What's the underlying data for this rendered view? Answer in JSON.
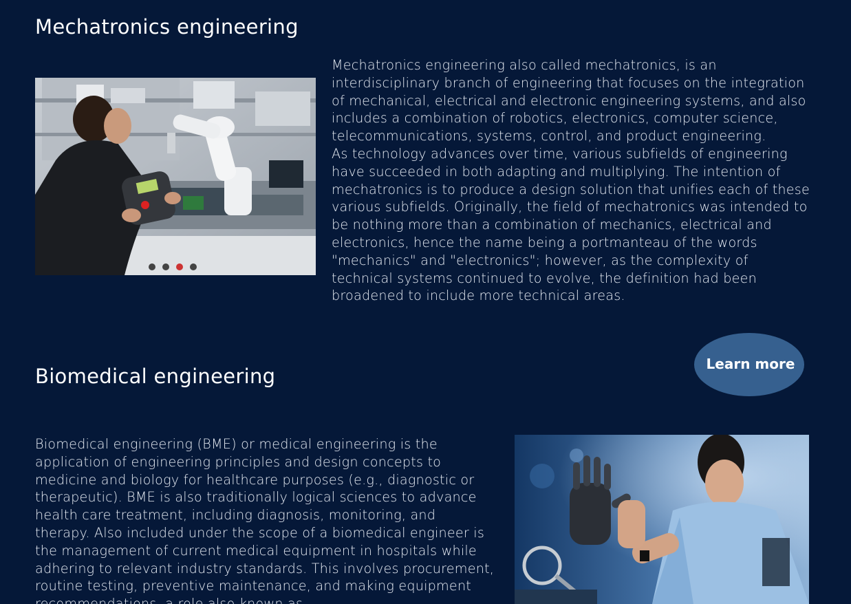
{
  "sections": {
    "mechatronics": {
      "title": "Mechatronics engineering",
      "paragraph1": "Mechatronics engineering also called mechatronics, is an interdisciplinary branch of engineering that focuses on the integration of mechanical, electrical and electronic engineering systems, and also includes a combination of robotics, electronics, computer science, telecommunications, systems, control, and product engineering.",
      "paragraph2": "As technology advances over time, various subfields of engineering have succeeded in both adapting and multiplying. The intention of mechatronics is to produce a design solution that unifies each of these various subfields. Originally, the field of mechatronics was intended to be nothing more than a combination of mechanics, electrical and electronics, hence the name being a portmanteau of the words \"mechanics\" and \"electronics\"; however, as the complexity of technical systems continued to evolve, the definition had been broadened to include more technical areas.",
      "image_subject": "engineer-with-robot-arm-photo"
    },
    "biomedical": {
      "title": "Biomedical engineering",
      "paragraph": "Biomedical engineering (BME) or medical engineering is the application of engineering principles and design concepts to medicine and biology for healthcare purposes (e.g., diagnostic or therapeutic). BME is also traditionally logical sciences to advance health care treatment, including diagnosis, monitoring, and therapy. Also included under the scope of a biomedical engineer is the management of current medical equipment in hospitals while adhering to relevant industry standards. This involves procurement, routine testing, preventive maintenance, and making equipment recommendations, a role also known as",
      "image_subject": "engineer-with-prosthetic-hand-photo"
    }
  },
  "learn_more_button": {
    "label": "Learn more"
  },
  "colors": {
    "background": "#051838",
    "button": "#36608f",
    "text": "#ffffff"
  }
}
